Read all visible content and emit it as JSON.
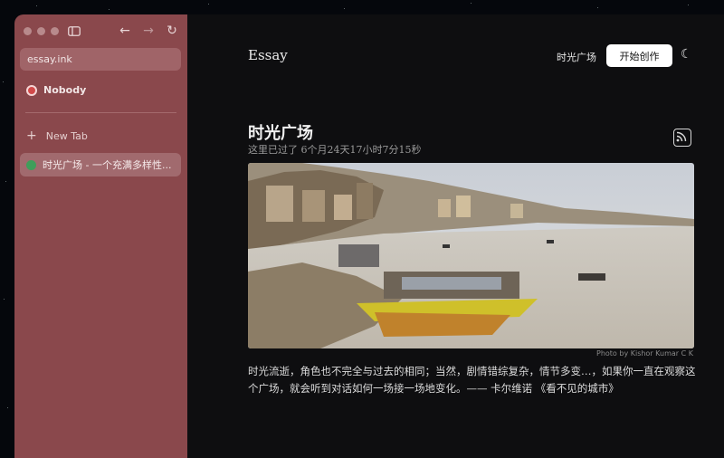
{
  "browser": {
    "url": "essay.ink",
    "profile": "Nobody",
    "new_tab_label": "New Tab",
    "active_tab_title": "时光广场 - 一个充满多样性..."
  },
  "site": {
    "brand": "Essay",
    "nav_link": "时光广场",
    "cta": "开始创作"
  },
  "post": {
    "title": "时光广场",
    "subtitle": "这里已过了 6个月24天17小时7分15秒",
    "photo_credit": "Photo by Kishor Kumar C K",
    "quote": "时光流逝，角色也不完全与过去的相同；当然，剧情错综复杂，情节多变…，如果你一直在观察这个广场，就会听到对话如何一场接一场地变化。—— 卡尔维诺 《看不见的城市》"
  },
  "icons": {
    "sidebar_toggle": "sidebar-icon",
    "back": "arrow-left-icon",
    "forward": "arrow-right-icon",
    "reload": "reload-icon",
    "theme": "moon-icon",
    "rss": "rss-icon"
  },
  "colors": {
    "sidebar": "#8a484c",
    "content_bg": "#0e0e10",
    "cta_bg": "#ffffff"
  }
}
